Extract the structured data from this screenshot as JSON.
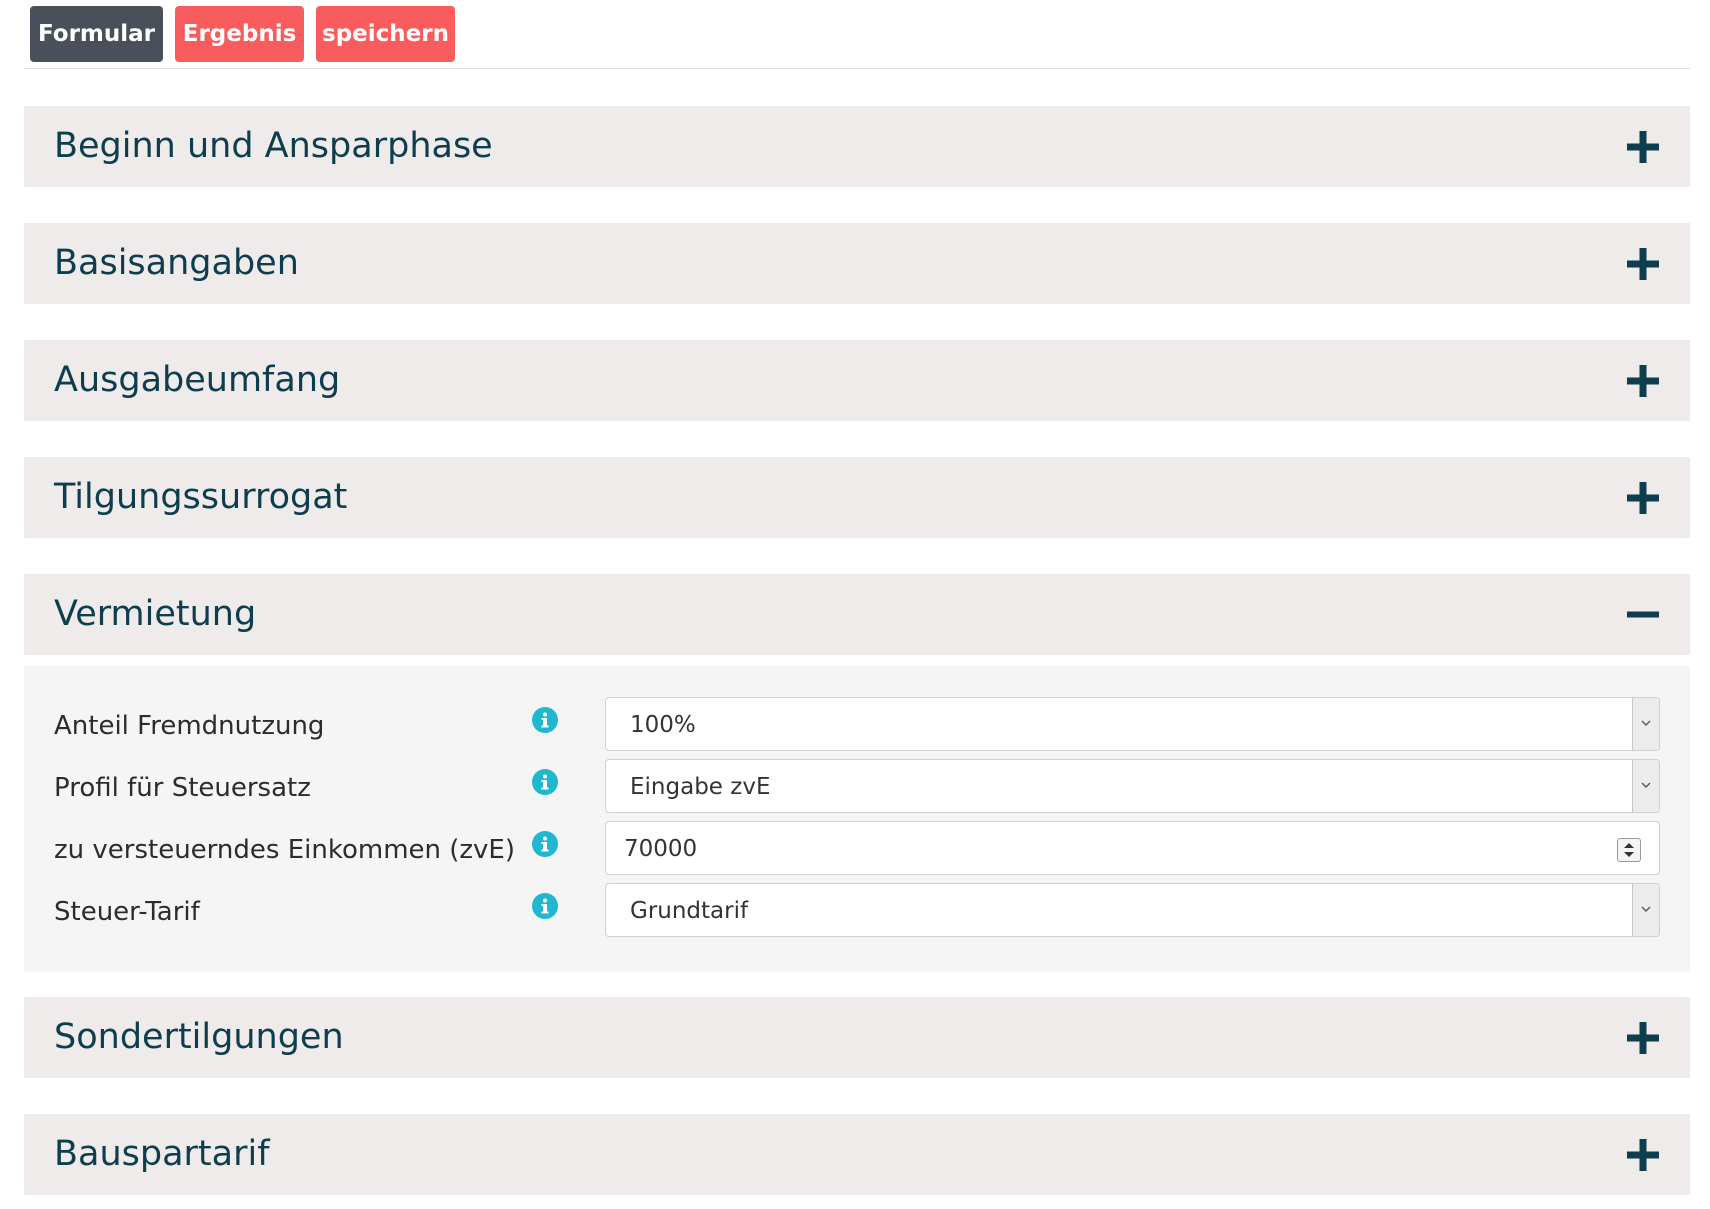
{
  "tabs": {
    "formular": "Formular",
    "ergebnis": "Ergebnis",
    "speichern": "speichern"
  },
  "colors": {
    "active_tab": "#4a5059",
    "inactive_tab": "#f95c5c",
    "section_bg": "#efebea",
    "section_title": "#0e3d4e",
    "info_icon": "#1fb8cf"
  },
  "sections": [
    {
      "title": "Beginn und Ansparphase",
      "state": "collapsed",
      "icon": "plus-icon"
    },
    {
      "title": "Basisangaben",
      "state": "collapsed",
      "icon": "plus-icon"
    },
    {
      "title": "Ausgabeumfang",
      "state": "collapsed",
      "icon": "plus-icon"
    },
    {
      "title": "Tilgungssurrogat",
      "state": "collapsed",
      "icon": "plus-icon"
    },
    {
      "title": "Vermietung",
      "state": "expanded",
      "icon": "minus-icon"
    },
    {
      "title": "Sondertilgungen",
      "state": "collapsed",
      "icon": "plus-icon"
    },
    {
      "title": "Bauspartarif",
      "state": "collapsed",
      "icon": "plus-icon"
    }
  ],
  "vermietung": {
    "fields": [
      {
        "label": "Anteil Fremdnutzung",
        "value": "100%",
        "type": "select"
      },
      {
        "label": "Profil für Steuersatz",
        "value": "Eingabe zvE",
        "type": "select"
      },
      {
        "label": "zu versteuerndes Einkommen (zvE)",
        "value": "70000",
        "type": "number"
      },
      {
        "label": "Steuer-Tarif",
        "value": "Grundtarif",
        "type": "select"
      }
    ]
  }
}
